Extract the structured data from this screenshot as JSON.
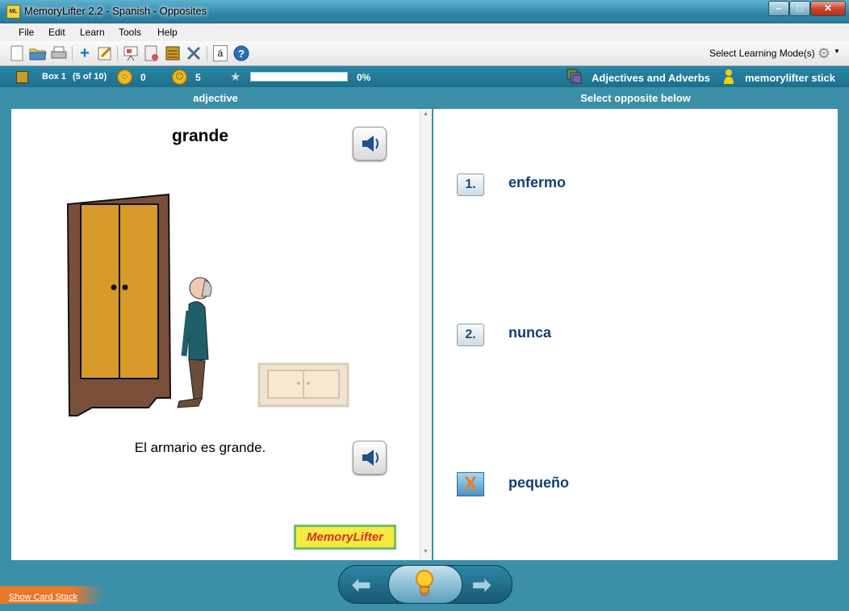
{
  "window": {
    "title": "MemoryLifter 2.2 - Spanish - Opposites",
    "icon_text": "ML"
  },
  "menu": [
    "File",
    "Edit",
    "Learn",
    "Tools",
    "Help"
  ],
  "toolbar": {
    "mode_label": "Select Learning Mode(s)",
    "accent_char": "á"
  },
  "status": {
    "box_label": "Box 1",
    "box_count": "(5 of 10)",
    "correct_count": "0",
    "wrong_count": "5",
    "progress_percent": 0,
    "progress_text": "0%",
    "chapter": "Adjectives and Adverbs",
    "user": "memorylifter stick"
  },
  "question": {
    "header": "adjective",
    "word": "grande",
    "sentence": "El armario es grande.",
    "logo_text": "MemoryLifter"
  },
  "answers": {
    "header": "Select opposite below",
    "options": [
      {
        "marker": "1.",
        "text": "enfermo"
      },
      {
        "marker": "2.",
        "text": "nunca"
      },
      {
        "marker": "X",
        "text": "pequeño"
      }
    ]
  },
  "footer": {
    "show_stack": "Show Card Stack"
  },
  "colors": {
    "accent": "#3b8fa8",
    "answer_text": "#123f71",
    "progress_fill": "#7bc043"
  }
}
